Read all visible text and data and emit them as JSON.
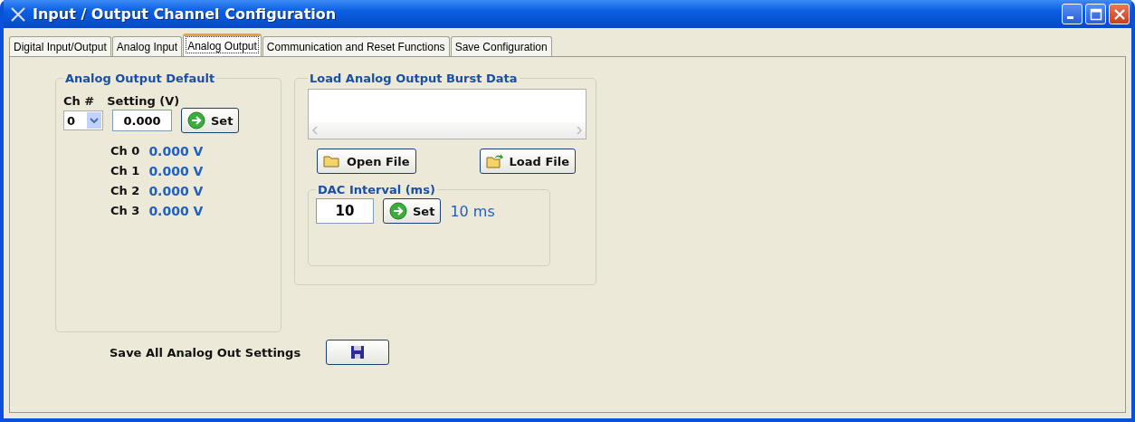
{
  "window": {
    "title": "Input / Output Channel Configuration"
  },
  "tabs": [
    {
      "label": "Digital Input/Output",
      "selected": false
    },
    {
      "label": "Analog Input",
      "selected": false
    },
    {
      "label": "Analog Output",
      "selected": true
    },
    {
      "label": "Communication and Reset Functions",
      "selected": false
    },
    {
      "label": "Save Configuration",
      "selected": false
    }
  ],
  "default_group": {
    "title": "Analog Output Default",
    "channel_label": "Ch #",
    "setting_label": "Setting (V)",
    "channel_value": "0",
    "setting_value": "0.000",
    "set_button": "Set",
    "readings": [
      {
        "channel": "Ch 0",
        "value": "0.000 V"
      },
      {
        "channel": "Ch 1",
        "value": "0.000 V"
      },
      {
        "channel": "Ch 2",
        "value": "0.000 V"
      },
      {
        "channel": "Ch 3",
        "value": "0.000 V"
      }
    ]
  },
  "burst_group": {
    "title": "Load Analog Output Burst Data",
    "open_button": "Open File",
    "load_button": "Load File",
    "dac": {
      "title": "DAC Interval (ms)",
      "value": "10",
      "set_button": "Set",
      "reading": "10 ms"
    }
  },
  "save": {
    "label": "Save All Analog Out Settings"
  }
}
